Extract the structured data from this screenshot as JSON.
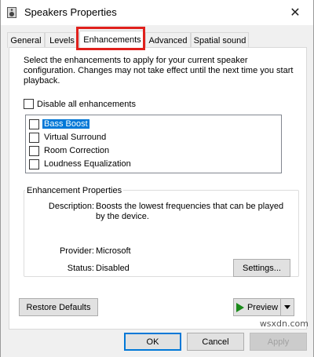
{
  "window": {
    "title": "Speakers Properties",
    "close_glyph": "✕"
  },
  "tabs": [
    {
      "label": "General"
    },
    {
      "label": "Levels"
    },
    {
      "label": "Enhancements",
      "active": true
    },
    {
      "label": "Advanced"
    },
    {
      "label": "Spatial sound"
    }
  ],
  "intro_text": "Select the enhancements to apply for your current speaker configuration. Changes may not take effect until the next time you start playback.",
  "disable_all": {
    "label": "Disable all enhancements",
    "checked": false
  },
  "enhancements": [
    {
      "label": "Bass Boost",
      "checked": false,
      "selected": true
    },
    {
      "label": "Virtual Surround",
      "checked": false
    },
    {
      "label": "Room Correction",
      "checked": false
    },
    {
      "label": "Loudness Equalization",
      "checked": false
    }
  ],
  "properties": {
    "group_title": "Enhancement Properties",
    "description_label": "Description:",
    "description_value": "Boosts the lowest frequencies that can be played by the device.",
    "provider_label": "Provider:",
    "provider_value": "Microsoft",
    "status_label": "Status:",
    "status_value": "Disabled",
    "settings_button": "Settings..."
  },
  "buttons": {
    "restore_defaults": "Restore Defaults",
    "preview": "Preview",
    "ok": "OK",
    "cancel": "Cancel",
    "apply": "Apply"
  },
  "watermark": "wsxdn.com",
  "colors": {
    "highlight": "#e0201c",
    "selection": "#0078d7",
    "play": "#1a8a1a"
  }
}
